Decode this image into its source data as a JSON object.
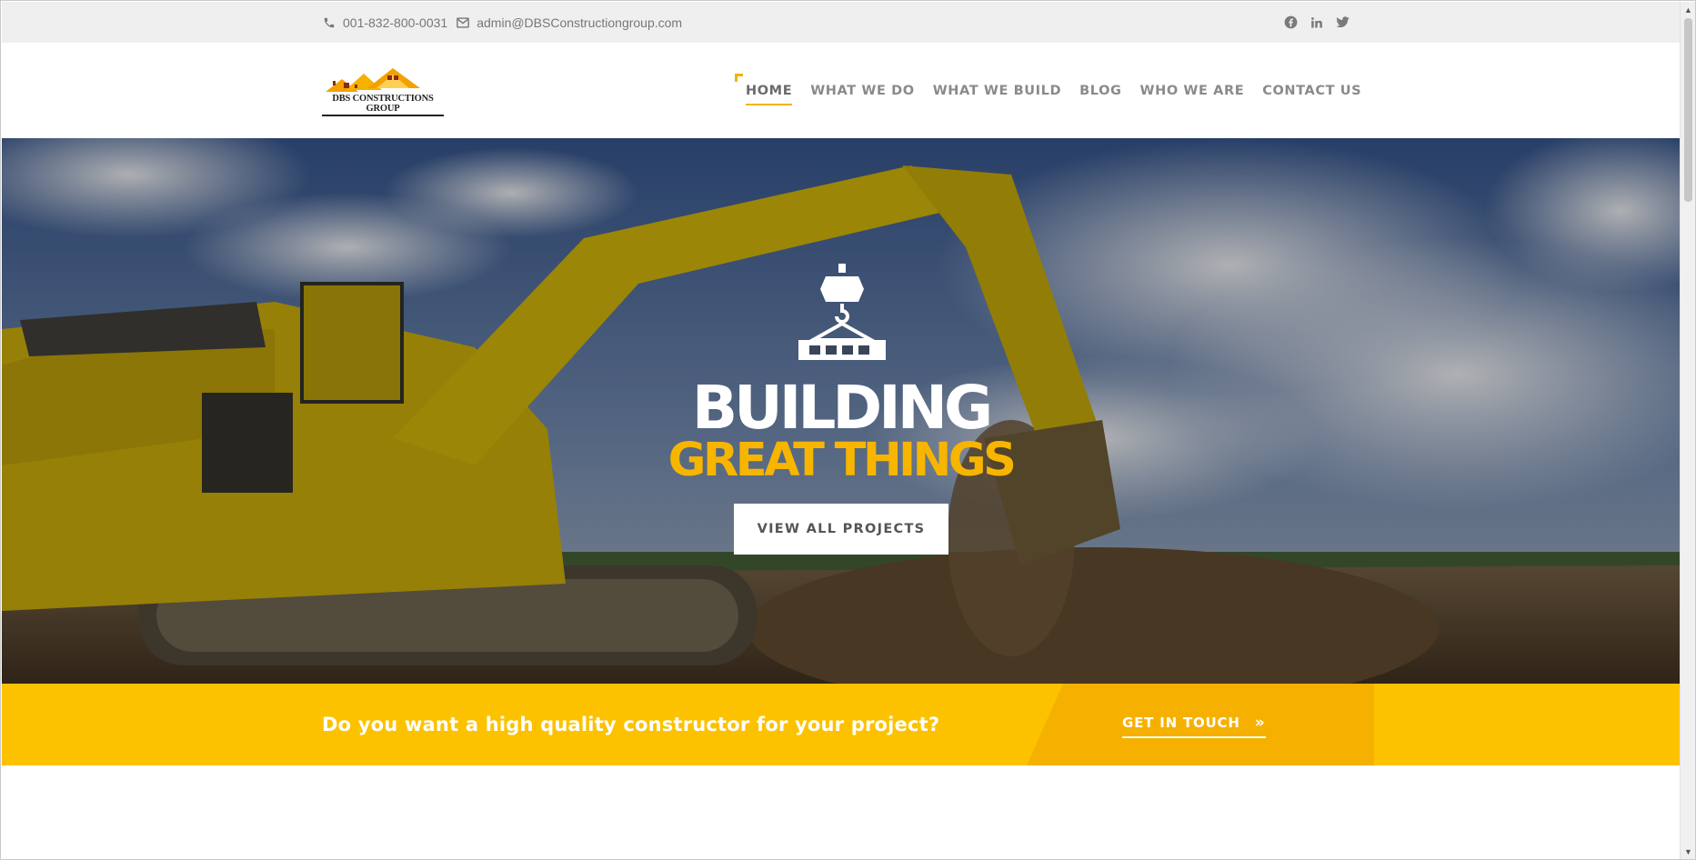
{
  "topbar": {
    "phone": "001-832-800-0031",
    "email": "admin@DBSConstructiongroup.com",
    "social": [
      "facebook-icon",
      "linkedin-icon",
      "twitter-icon"
    ]
  },
  "header": {
    "logo_text": "DBS CONSTRUCTIONS GROUP",
    "nav": [
      {
        "label": "HOME",
        "active": true
      },
      {
        "label": "WHAT WE DO",
        "active": false
      },
      {
        "label": "WHAT WE BUILD",
        "active": false
      },
      {
        "label": "BLOG",
        "active": false
      },
      {
        "label": "WHO WE ARE",
        "active": false
      },
      {
        "label": "CONTACT US",
        "active": false
      }
    ]
  },
  "hero": {
    "title_line1": "BUILDING",
    "title_line2": "GREAT THINGS",
    "button_label": "VIEW ALL PROJECTS",
    "icon": "crane-hook-icon"
  },
  "cta": {
    "text": "Do you want a high quality constructor for your project?",
    "link_label": "GET IN TOUCH",
    "link_icon": "double-chevron-right-icon"
  },
  "colors": {
    "accent": "#f7b500",
    "cta_band": "#fcc200",
    "cta_slant": "#f6b100",
    "topbar_bg": "#efefef",
    "nav_text": "#8a8a8a"
  }
}
